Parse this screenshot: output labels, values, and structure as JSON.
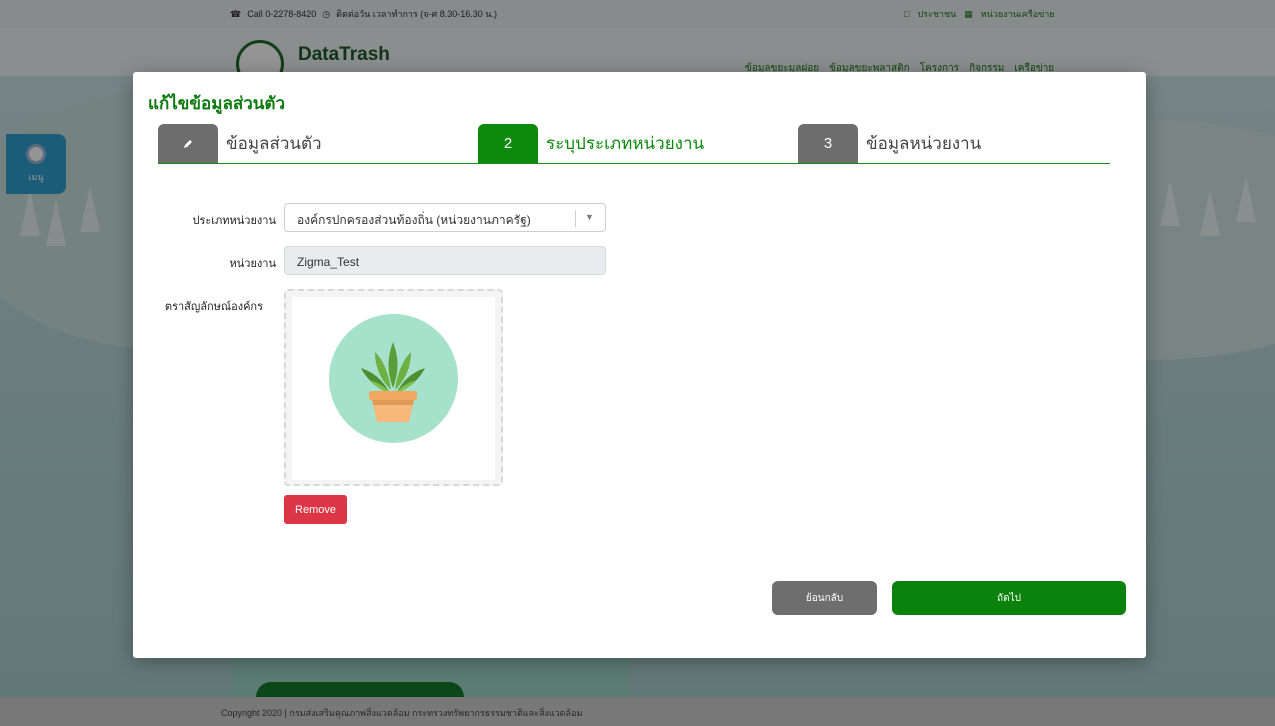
{
  "background": {
    "topbar": {
      "phone": "Call 0-2278-8420",
      "hours": "ติดต่อวัน เวลาทำการ (จ-ศ 8.30-16.30 น.)",
      "links": [
        "ประชาชน",
        "หน่วยงานเครือข่าย"
      ]
    },
    "brand": "DataTrash",
    "nav": [
      "ข้อมูลขยะมูลฝอย",
      "ข้อมูลขยะพลาสติก",
      "โครงการ",
      "กิจกรรม",
      "เครือข่าย"
    ],
    "side_menu_label": "เมนู",
    "footer": "Copyright 2020 | กรมส่งเสริมคุณภาพสิ่งแวดล้อม กระทรวงทรัพยากรธรรมชาติและสิ่งแวดล้อม"
  },
  "modal": {
    "title": "แก้ไขข้อมูลส่วนตัว",
    "steps": [
      {
        "number": "",
        "label": "ข้อมูลส่วนตัว",
        "state": "done"
      },
      {
        "number": "2",
        "label": "ระบุประเภทหน่วยงาน",
        "state": "active"
      },
      {
        "number": "3",
        "label": "ข้อมูลหน่วยงาน",
        "state": "pending"
      }
    ],
    "form": {
      "org_type_label": "ประเภทหน่วยงาน",
      "org_type_value": "องค์กรปกครองส่วนท้องถิ่น (หน่วยงานภาครัฐ)",
      "org_label": "หน่วยงาน",
      "org_value": "Zigma_Test",
      "logo_label": "ตราสัญลักษณ์องค์กร"
    },
    "buttons": {
      "remove": "Remove",
      "back": "ย้อนกลับ",
      "next": "ถัดไป"
    },
    "colors": {
      "accent": "#0b8a0b",
      "step_inactive": "#6d6d6d",
      "danger": "#dc3545"
    }
  }
}
